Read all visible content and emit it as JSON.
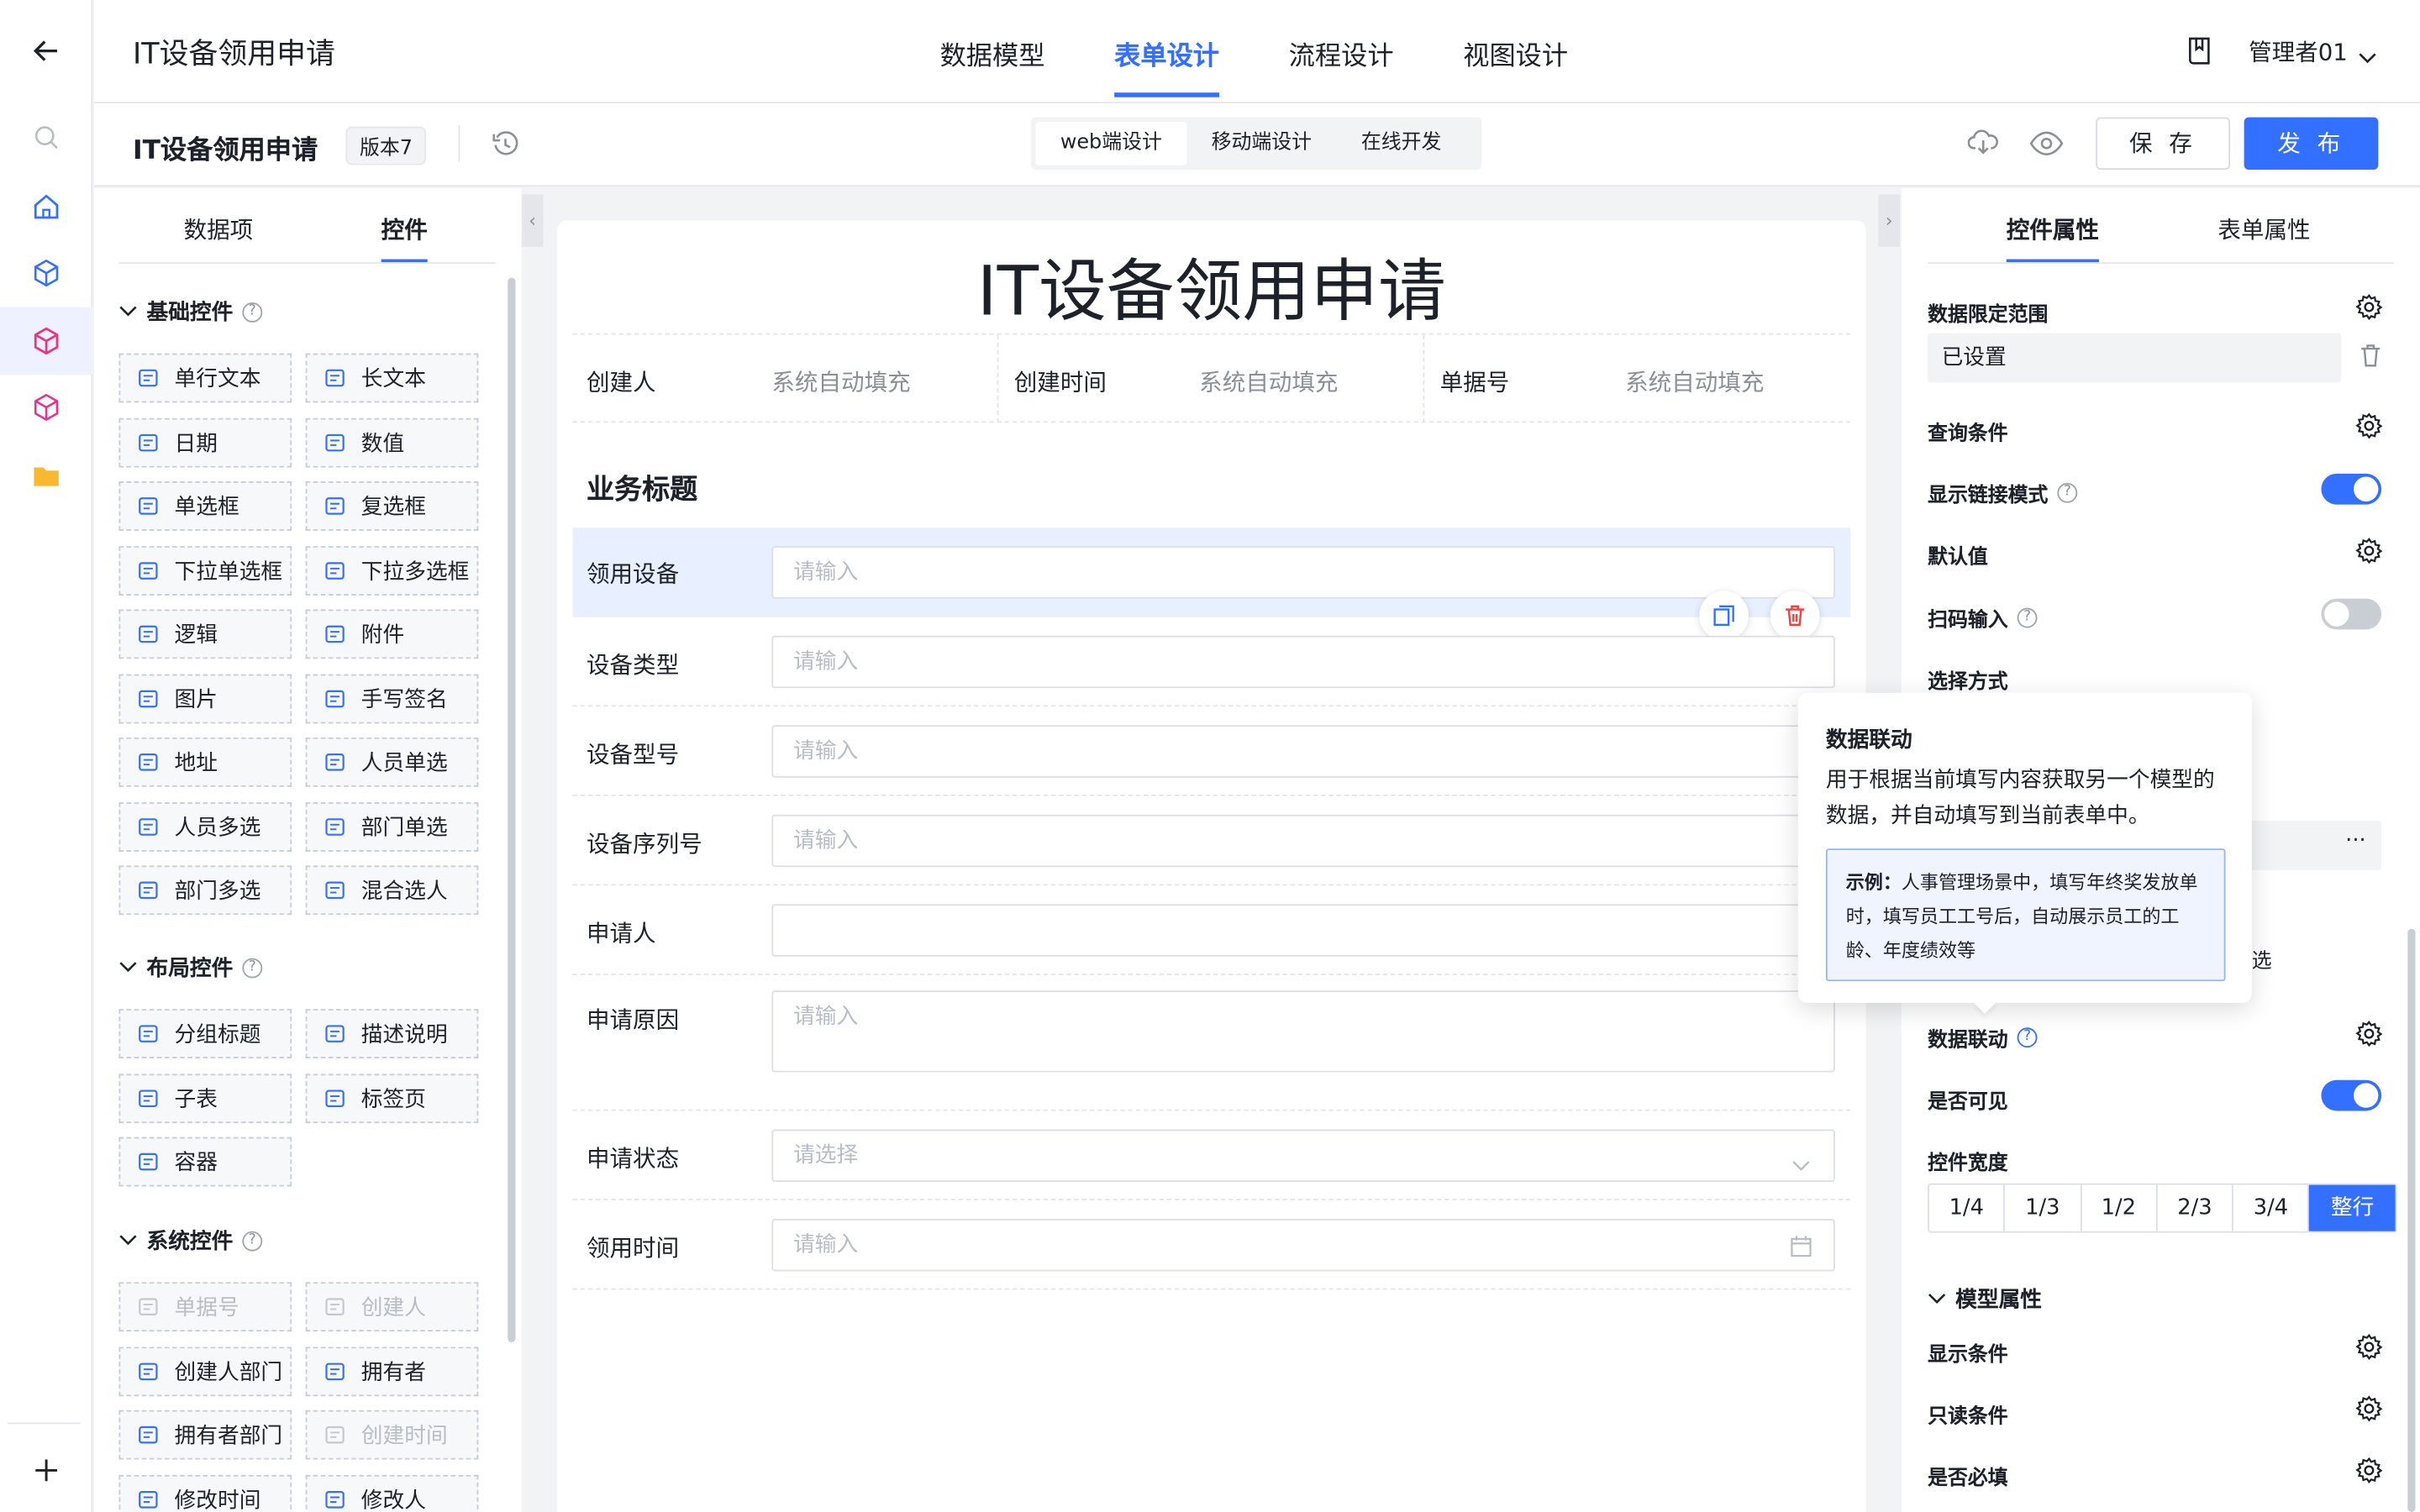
{
  "colors": {
    "accent": "#3370ff",
    "danger": "#f53f3f"
  },
  "header": {
    "app_title": "IT设备领用申请",
    "tabs": [
      "数据模型",
      "表单设计",
      "流程设计",
      "视图设计"
    ],
    "active_tab": "表单设计",
    "user": "管理者01"
  },
  "subheader": {
    "form_name": "IT设备领用申请",
    "version": "版本7",
    "modes": [
      "web端设计",
      "移动端设计",
      "在线开发"
    ],
    "active_mode": "web端设计",
    "save": "保 存",
    "publish": "发 布"
  },
  "left_panel": {
    "tabs": [
      "数据项",
      "控件"
    ],
    "active_tab": "控件",
    "groups": [
      {
        "title": "基础控件",
        "items": [
          {
            "label": "单行文本",
            "icon": "single-line-text-icon"
          },
          {
            "label": "长文本",
            "icon": "long-text-icon"
          },
          {
            "label": "日期",
            "icon": "calendar-icon"
          },
          {
            "label": "数值",
            "icon": "number-icon"
          },
          {
            "label": "单选框",
            "icon": "radio-icon"
          },
          {
            "label": "复选框",
            "icon": "checkbox-icon"
          },
          {
            "label": "下拉单选框",
            "icon": "dropdown-single-icon"
          },
          {
            "label": "下拉多选框",
            "icon": "dropdown-multi-icon"
          },
          {
            "label": "逻辑",
            "icon": "toggle-icon"
          },
          {
            "label": "附件",
            "icon": "paperclip-icon"
          },
          {
            "label": "图片",
            "icon": "image-icon"
          },
          {
            "label": "手写签名",
            "icon": "pen-icon"
          },
          {
            "label": "地址",
            "icon": "location-icon"
          },
          {
            "label": "人员单选",
            "icon": "user-single-icon"
          },
          {
            "label": "人员多选",
            "icon": "users-icon"
          },
          {
            "label": "部门单选",
            "icon": "department-icon"
          },
          {
            "label": "部门多选",
            "icon": "departments-icon"
          },
          {
            "label": "混合选人",
            "icon": "mixed-select-icon"
          }
        ]
      },
      {
        "title": "布局控件",
        "items": [
          {
            "label": "分组标题",
            "icon": "heading-icon"
          },
          {
            "label": "描述说明",
            "icon": "question-icon"
          },
          {
            "label": "子表",
            "icon": "table-icon"
          },
          {
            "label": "标签页",
            "icon": "tabs-icon"
          },
          {
            "label": "容器",
            "icon": "cube-icon"
          }
        ]
      },
      {
        "title": "系统控件",
        "items": [
          {
            "label": "单据号",
            "icon": "barcode-icon",
            "disabled": true
          },
          {
            "label": "创建人",
            "icon": "user-icon",
            "disabled": true
          },
          {
            "label": "创建人部门",
            "icon": "org-icon"
          },
          {
            "label": "拥有者",
            "icon": "owner-icon"
          },
          {
            "label": "拥有者部门",
            "icon": "owner-dept-icon"
          },
          {
            "label": "创建时间",
            "icon": "clock-icon",
            "disabled": true
          },
          {
            "label": "修改时间",
            "icon": "clock-edit-icon"
          },
          {
            "label": "修改人",
            "icon": "user-edit-icon"
          }
        ]
      }
    ]
  },
  "form": {
    "title": "IT设备领用申请",
    "meta": [
      {
        "label": "创建人",
        "value": "系统自动填充"
      },
      {
        "label": "创建时间",
        "value": "系统自动填充"
      },
      {
        "label": "单据号",
        "value": "系统自动填充"
      }
    ],
    "section_title": "业务标题",
    "fields": [
      {
        "label": "领用设备",
        "placeholder": "请输入"
      },
      {
        "label": "设备类型",
        "placeholder": "请输入"
      },
      {
        "label": "设备型号",
        "placeholder": "请输入"
      },
      {
        "label": "设备序列号",
        "placeholder": "请输入"
      },
      {
        "label": "申请人",
        "placeholder": ""
      },
      {
        "label": "申请原因",
        "placeholder": "请输入"
      },
      {
        "label": "申请状态",
        "placeholder": "请选择"
      },
      {
        "label": "领用时间",
        "placeholder": "请输入"
      }
    ]
  },
  "right_panel": {
    "tabs": [
      "控件属性",
      "表单属性"
    ],
    "active_tab": "控件属性",
    "data_scope": {
      "label": "数据限定范围",
      "value": "已设置"
    },
    "query": "查询条件",
    "link_mode": {
      "label": "显示链接模式",
      "on": true
    },
    "default_value": "默认值",
    "scan_input": {
      "label": "扫码输入",
      "on": false
    },
    "select_mode": "选择方式",
    "partial_text": "选",
    "more": "···",
    "data_link": "数据联动",
    "visible": {
      "label": "是否可见",
      "on": true
    },
    "width": {
      "label": "控件宽度",
      "options": [
        "1/4",
        "1/3",
        "1/2",
        "2/3",
        "3/4",
        "整行"
      ],
      "selected": "整行"
    },
    "model_section": "模型属性",
    "display_cond": "显示条件",
    "readonly_cond": "只读条件",
    "required": "是否必填"
  },
  "tooltip": {
    "title": "数据联动",
    "desc": "用于根据当前填写内容获取另一个模型的数据，并自动填写到当前表单中。",
    "example_label": "示例：",
    "example": "人事管理场景中，填写年终奖发放单时，填写员工工号后，自动展示员工的工龄、年度绩效等"
  }
}
